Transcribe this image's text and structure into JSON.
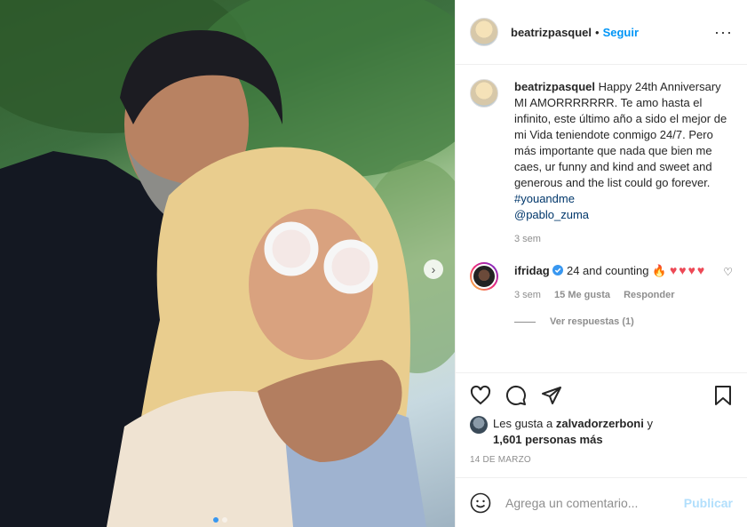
{
  "post": {
    "username": "beatrizpasquel",
    "separator": "•",
    "follow_label": "Seguir",
    "more_label": "···",
    "caption": {
      "username": "beatrizpasquel",
      "text": "Happy 24th Anniversary MI AMORRRRRRR. Te amo hasta el infinito, este último año a sido el mejor de mi Vida teniendote conmigo 24/7. Pero más importante que nada que bien me caes, ur funny and kind and sweet and generous and the list could go forever.",
      "hashtag": "#youandme",
      "mention": "@pablo_zuma",
      "time": "3 sem"
    },
    "comments": [
      {
        "username": "ifridag",
        "text": "24 and counting",
        "fire": "🔥",
        "hearts": "♥♥♥♥",
        "time": "3 sem",
        "likes": "15 Me gusta",
        "reply_label": "Responder",
        "view_replies": "Ver respuestas (1)"
      }
    ],
    "likes": {
      "prefix": "Les gusta a",
      "user": "zalvadorzerboni",
      "connector": "y",
      "others": "1,601 personas más"
    },
    "date": "14 DE MARZO",
    "add_comment": {
      "placeholder": "Agrega un comentario...",
      "post_label": "Publicar"
    },
    "carousel": {
      "current": 1,
      "total": 2
    }
  },
  "colors": {
    "accent": "#0095f6",
    "heart": "#ed4956",
    "muted": "#8e8e8e",
    "verified": "#3897f0"
  }
}
